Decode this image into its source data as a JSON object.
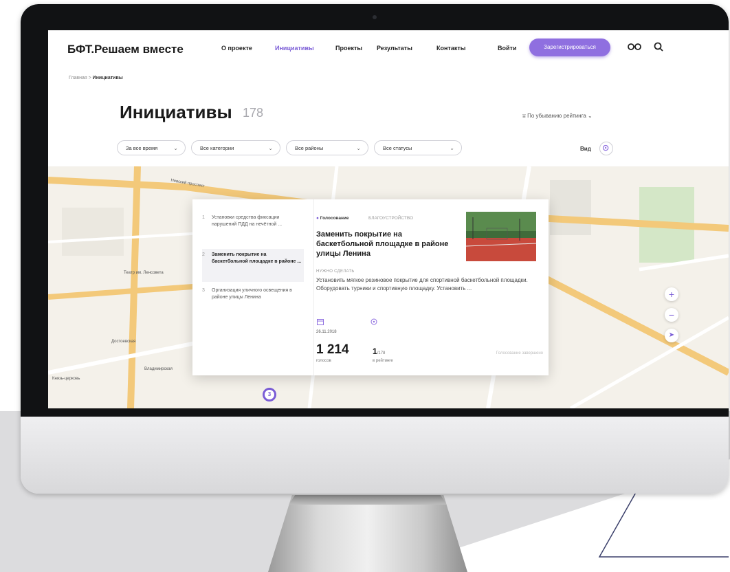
{
  "header": {
    "logo": "БФТ.Решаем вместе",
    "nav": [
      "О проекте",
      "Инициативы",
      "Проекты",
      "Результаты",
      "Контакты"
    ],
    "active_nav": "Инициативы",
    "login": "Войти",
    "register": "Зарегистрироваться"
  },
  "breadcrumb": {
    "home": "Главная",
    "separator": ">",
    "current": "Инициативы"
  },
  "page": {
    "title": "Инициативы",
    "count": "178",
    "sort": "По убыванию рейтинга"
  },
  "filters": [
    "За все время",
    "Все категории",
    "Все районы",
    "Все статусы"
  ],
  "view_label": "Вид",
  "map_labels": {
    "street1": "Невский проспект",
    "place1": "Театр им. Ленсовета",
    "metro1": "Достоевская",
    "metro2": "Владимирская",
    "church": "Князь-церковь",
    "cluster": "3"
  },
  "list": [
    {
      "n": "1",
      "text": "Установки средства фиксации нарушений ПДД на нечётной ..."
    },
    {
      "n": "2",
      "text": "Заменить покрытие на баскетбольной площадке в районе ..."
    },
    {
      "n": "3",
      "text": "Организация уличного освещения в районе улицы Ленина"
    }
  ],
  "card": {
    "status_tag": "Голосование",
    "category": "БЛАГОУСТРОЙСТВО",
    "title": "Заменить покрытие на баскетбольной площадке в районе улицы Ленина",
    "section_label": "НУЖНО СДЕЛАТЬ",
    "description": "Установить мягкое резиновое покрытие для спортивной баскетбольной площадки. Оборудовать турники и спортивную площадку. Установить ...",
    "date": "26.11.2018",
    "votes": "1 214",
    "votes_label": "голосов",
    "rank": "1",
    "rank_total": "/178",
    "rank_label": "в рейтинге",
    "vote_status": "Голосование завершено"
  },
  "colors": {
    "accent": "#8f6fe0",
    "road": "#f3c97a"
  }
}
